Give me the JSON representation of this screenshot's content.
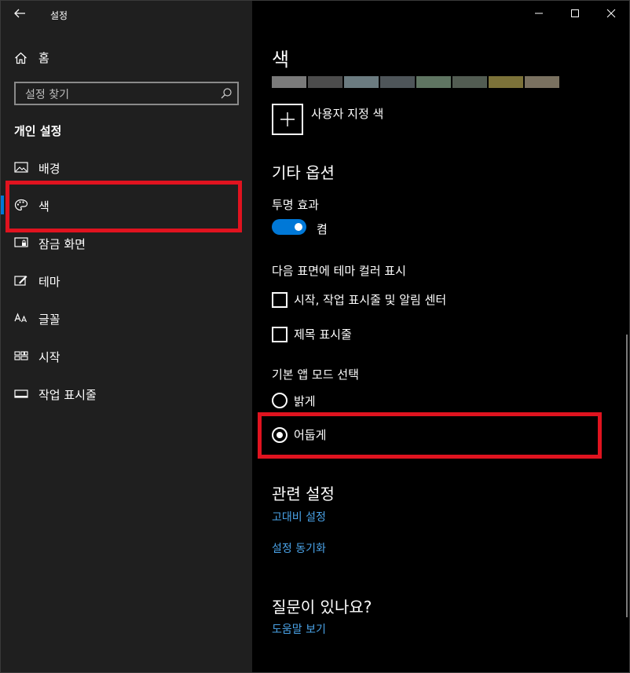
{
  "window": {
    "title": "설정"
  },
  "sidebar": {
    "home_label": "홈",
    "search_placeholder": "설정 찾기",
    "section_title": "개인 설정",
    "items": [
      {
        "label": "배경",
        "icon": "picture-icon"
      },
      {
        "label": "색",
        "icon": "palette-icon"
      },
      {
        "label": "잠금 화면",
        "icon": "lock-screen-icon"
      },
      {
        "label": "테마",
        "icon": "theme-brush-icon"
      },
      {
        "label": "글꼴",
        "icon": "font-icon"
      },
      {
        "label": "시작",
        "icon": "start-grid-icon"
      },
      {
        "label": "작업 표시줄",
        "icon": "taskbar-icon"
      }
    ],
    "selected_index": 1
  },
  "main": {
    "color_heading": "색",
    "swatches": [
      "#7a7a7a",
      "#4c4c4c",
      "#6b7b80",
      "#4e5559",
      "#5f7562",
      "#525c52",
      "#7c7239",
      "#7a7160"
    ],
    "custom_color_label": "사용자 지정 색",
    "other_options_heading": "기타 옵션",
    "transparency_label": "투명 효과",
    "transparency_state": "켬",
    "accent_surface_label": "다음 표면에 테마 컬러 표시",
    "checkbox_start": "시작, 작업 표시줄 및 알림 센터",
    "checkbox_titlebar": "제목 표시줄",
    "app_mode_label": "기본 앱 모드 선택",
    "radio_light": "밝게",
    "radio_dark": "어둡게",
    "related_heading": "관련 설정",
    "link_contrast": "고대비 설정",
    "link_sync": "설정 동기화",
    "question_heading": "질문이 있나요?",
    "link_help": "도움말 보기"
  },
  "colors": {
    "accent": "#0078d7",
    "link": "#4aa3e8",
    "highlight": "#e0131f"
  }
}
